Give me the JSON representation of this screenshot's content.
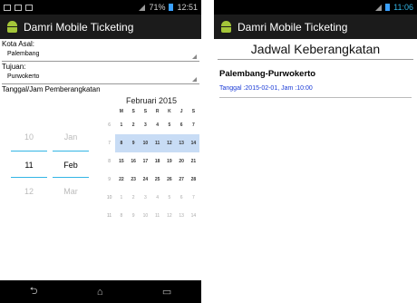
{
  "phone1": {
    "status": {
      "clock": "12:51",
      "battery_pct": "71%"
    },
    "title": "Damri Mobile Ticketing",
    "fields": {
      "origin_label": "Kota Asal:",
      "origin_value": "Palembang",
      "dest_label": "Tujuan:",
      "dest_value": "Purwokerto",
      "datetime_label": "Tanggal/Jam Pemberangkatan"
    },
    "picker": {
      "days": [
        "10",
        "11",
        "12"
      ],
      "months": [
        "Jan",
        "Feb",
        "Mar"
      ],
      "selected_index": 1
    },
    "calendar": {
      "title": "Februari 2015",
      "weekday_headers": [
        "M",
        "S",
        "S",
        "R",
        "K",
        "J",
        "S"
      ],
      "rows": [
        {
          "wk": "6",
          "days": [
            "1",
            "2",
            "3",
            "4",
            "5",
            "6",
            "7"
          ]
        },
        {
          "wk": "7",
          "days": [
            "8",
            "9",
            "10",
            "11",
            "12",
            "13",
            "14"
          ]
        },
        {
          "wk": "8",
          "days": [
            "15",
            "16",
            "17",
            "18",
            "19",
            "20",
            "21"
          ]
        },
        {
          "wk": "9",
          "days": [
            "22",
            "23",
            "24",
            "25",
            "26",
            "27",
            "28"
          ]
        },
        {
          "wk": "10",
          "days": [
            "1",
            "2",
            "3",
            "4",
            "5",
            "6",
            "7"
          ]
        },
        {
          "wk": "11",
          "days": [
            "8",
            "9",
            "10",
            "11",
            "12",
            "13",
            "14"
          ]
        }
      ]
    },
    "navbar": {
      "back": "⮌",
      "home": "⌂",
      "recent": "▭"
    }
  },
  "phone2": {
    "status": {
      "clock": "11:06"
    },
    "title": "Damri Mobile Ticketing",
    "header": "Jadwal Keberangkatan",
    "route": "Palembang-Purwokerto",
    "schedule": "Tanggal :2015-02-01, Jam :10:00"
  },
  "colors": {
    "accent": "#33b5e5",
    "android_green": "#a4c639",
    "link_blue": "#1a3bd6"
  }
}
